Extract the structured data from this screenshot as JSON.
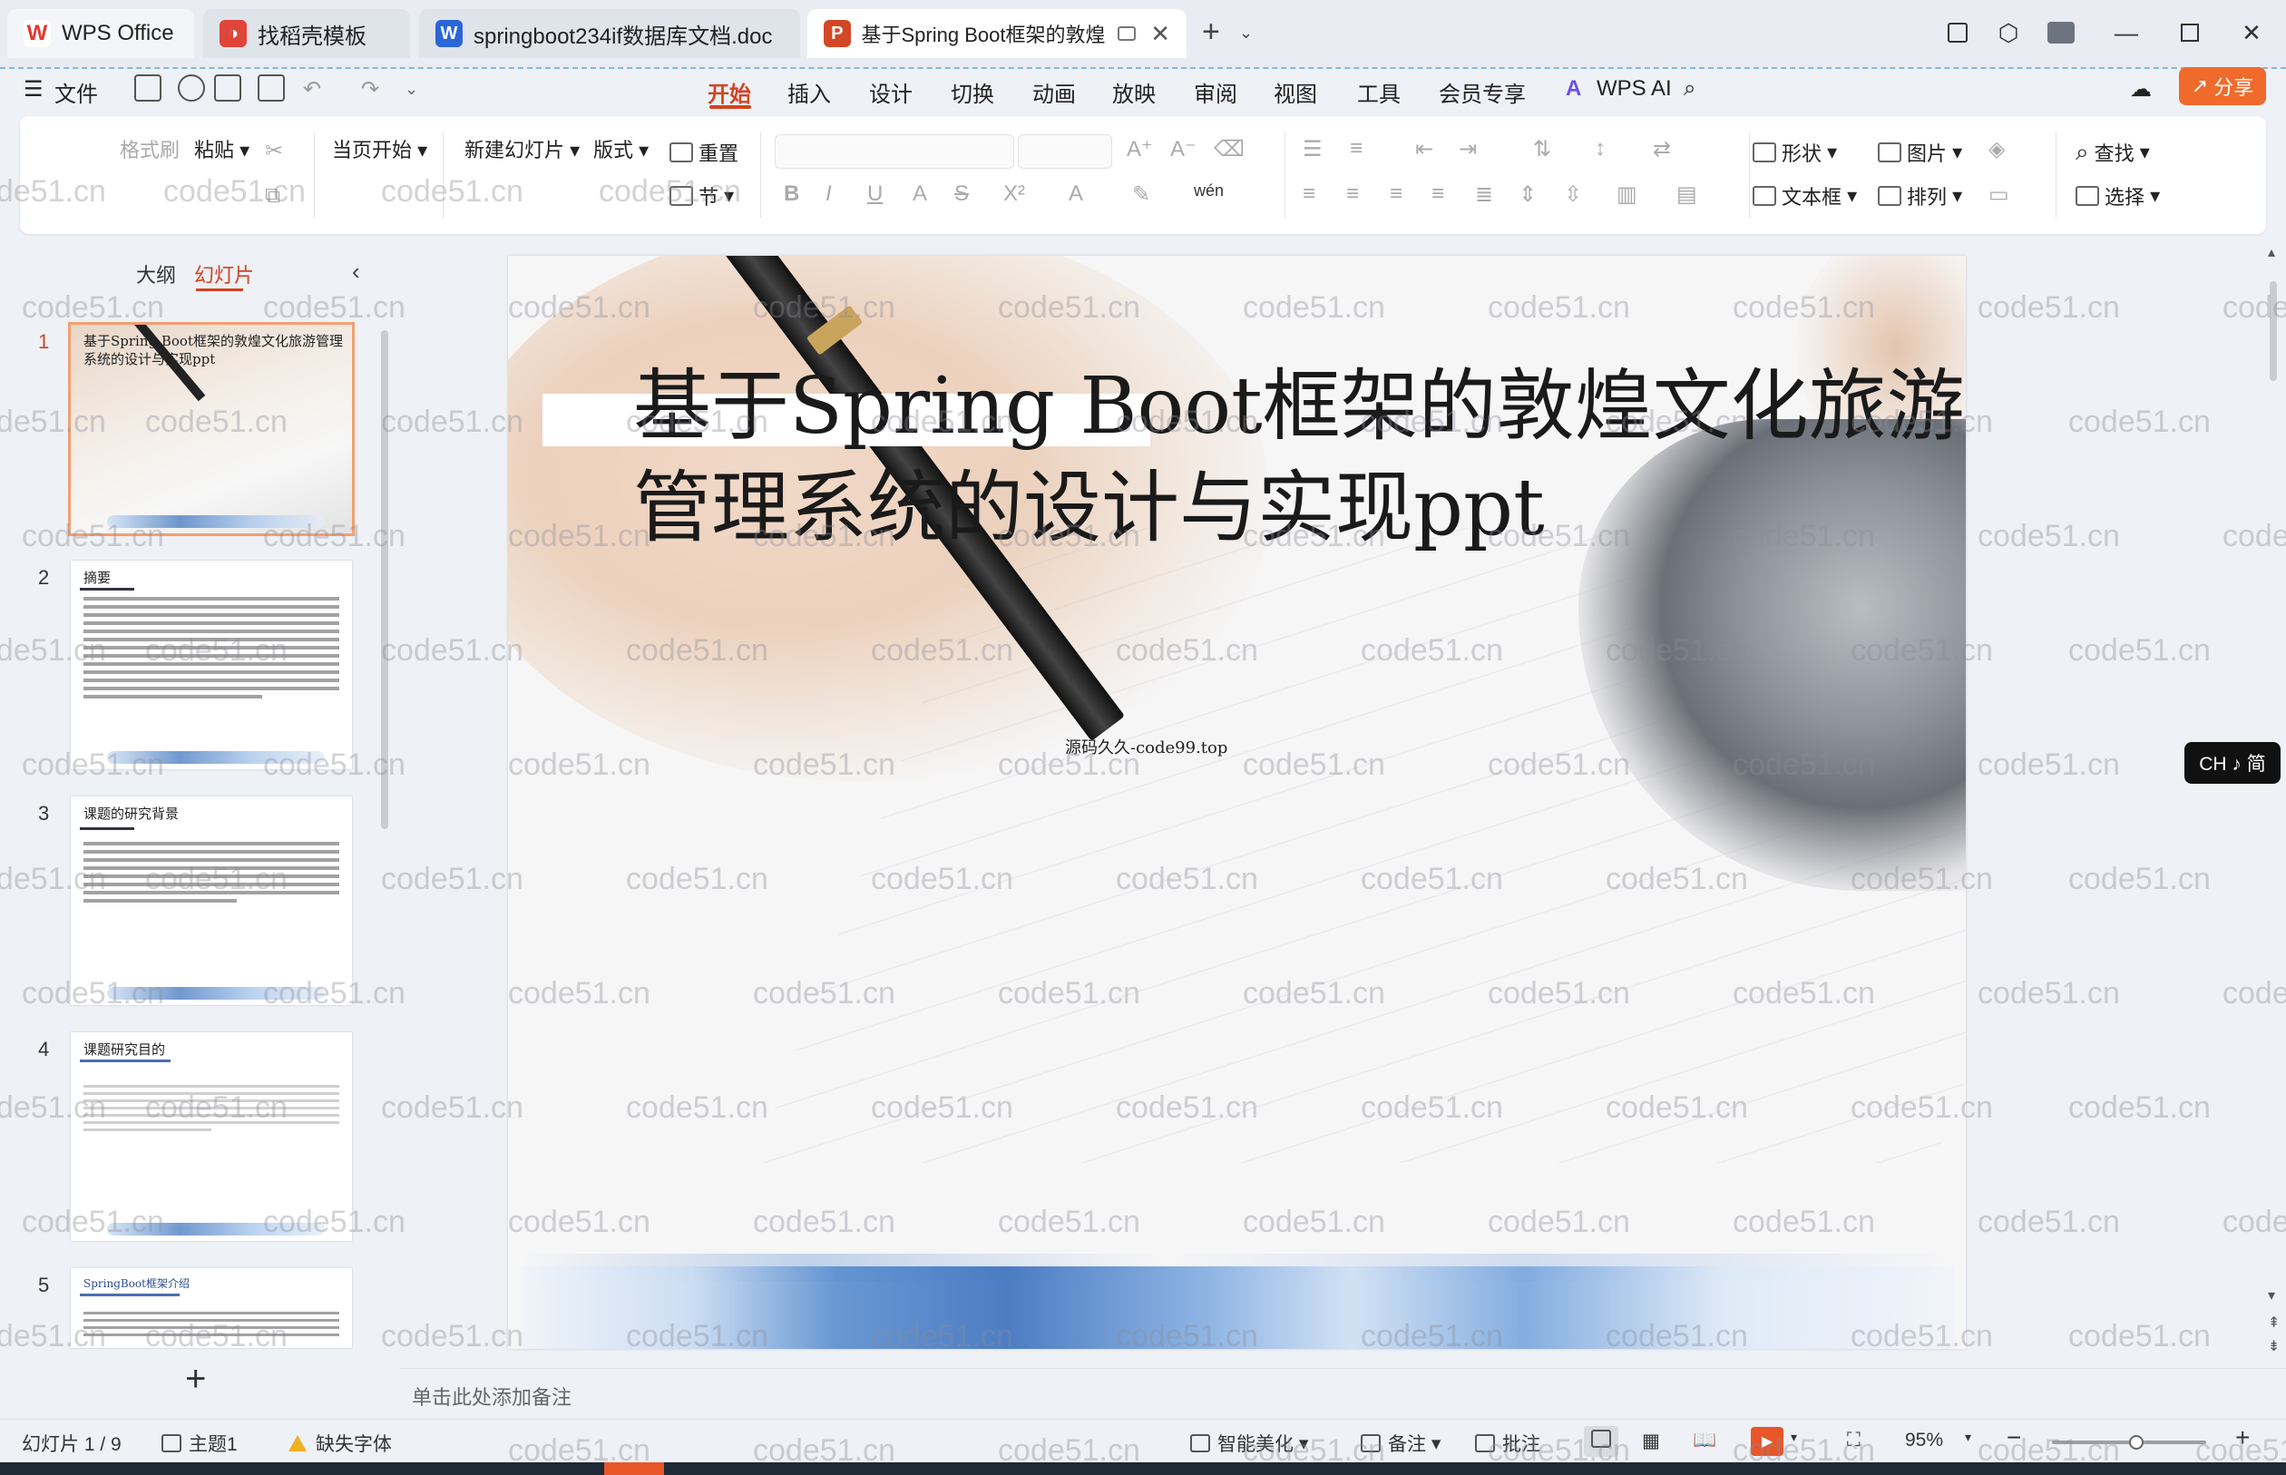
{
  "titlebar": {
    "tabs": [
      {
        "label": "WPS Office",
        "icon": "wps-logo-icon",
        "color": "#e03a2e"
      },
      {
        "label": "找稻壳模板",
        "icon": "docer-icon",
        "color": "#e0453a"
      },
      {
        "label": "springboot234if数据库文档.doc",
        "icon": "word-doc-icon",
        "color": "#2b66d9"
      },
      {
        "label": "基于Spring Boot框架的敦煌",
        "icon": "ppt-icon",
        "color": "#d24726"
      }
    ]
  },
  "menubar": {
    "file": "文件",
    "items": [
      "开始",
      "插入",
      "设计",
      "切换",
      "动画",
      "放映",
      "审阅",
      "视图",
      "工具",
      "会员专享"
    ],
    "active": "开始",
    "wps_ai": "WPS AI",
    "share": "分享"
  },
  "ribbon": {
    "format_painter": "格式刷",
    "paste": "粘贴",
    "start_from_current": "当页开始",
    "new_slide": "新建幻灯片",
    "layout": "版式",
    "reset": "重置",
    "section": "节",
    "shape": "形状",
    "picture": "图片",
    "find": "查找",
    "textbox": "文本框",
    "arrange": "排列",
    "select": "选择"
  },
  "left_panel": {
    "tab_outline": "大纲",
    "tab_slides": "幻灯片",
    "slides": [
      {
        "num": "1",
        "title": "基于Spring Boot框架的敦煌文化旅游管理系统的设计与实现ppt"
      },
      {
        "num": "2",
        "title": "摘要"
      },
      {
        "num": "3",
        "title": "课题的研究背景"
      },
      {
        "num": "4",
        "title": "课题研究目的"
      },
      {
        "num": "5",
        "title": "SpringBoot框架介绍"
      }
    ]
  },
  "slide": {
    "title": "基于Spring Boot框架的敦煌文化旅游管理系统的设计与实现ppt",
    "subtitle": "源码久久-code99.top"
  },
  "notes": {
    "placeholder": "单击此处添加备注"
  },
  "statusbar": {
    "slide_counter": "幻灯片 1 / 9",
    "theme": "主题1",
    "missing_font": "缺失字体",
    "beautify": "智能美化",
    "notes": "备注",
    "comments": "批注",
    "zoom": "95%",
    "zoom_fraction": 0.55
  },
  "ime": {
    "label": "CH ♪ 简"
  },
  "watermark": {
    "text": "code51.cn"
  },
  "colors": {
    "accent": "#d14424",
    "share_bg": "#f06a2b"
  }
}
